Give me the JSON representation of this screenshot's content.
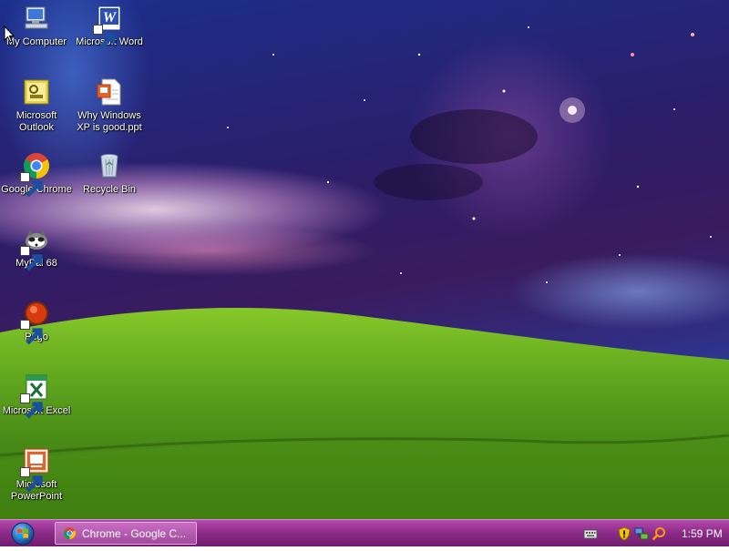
{
  "desktop": {
    "icons": [
      {
        "label": "My Computer",
        "icon": "my-computer-icon"
      },
      {
        "label": "Microsoft Word",
        "icon": "word-icon"
      },
      {
        "label": "Microsoft Outlook",
        "icon": "outlook-icon"
      },
      {
        "label": "Why Windows XP is good.ppt",
        "icon": "ppt-file-icon"
      },
      {
        "label": "Google Chrome",
        "icon": "chrome-icon"
      },
      {
        "label": "Recycle Bin",
        "icon": "recycle-bin-icon"
      },
      {
        "label": "MyPal 68",
        "icon": "mypal-icon"
      },
      {
        "label": "Pego",
        "icon": "pego-icon"
      },
      {
        "label": "Microsoft Excel",
        "icon": "excel-icon"
      },
      {
        "label": "Microsoft PowerPoint",
        "icon": "powerpoint-icon"
      }
    ]
  },
  "taskbar": {
    "start_icon": "windows-orb-icon",
    "tasks": [
      {
        "label": "Chrome - Google C...",
        "icon": "chrome-icon"
      }
    ],
    "tray": {
      "icons": [
        "keyboard-icon",
        "security-shield-icon",
        "network-icon",
        "search-icon"
      ],
      "clock": "1:59 PM"
    }
  },
  "colors": {
    "taskbar": "#8e2d8a",
    "grass": "#5aa01c",
    "sky": "#2b1e6a"
  }
}
